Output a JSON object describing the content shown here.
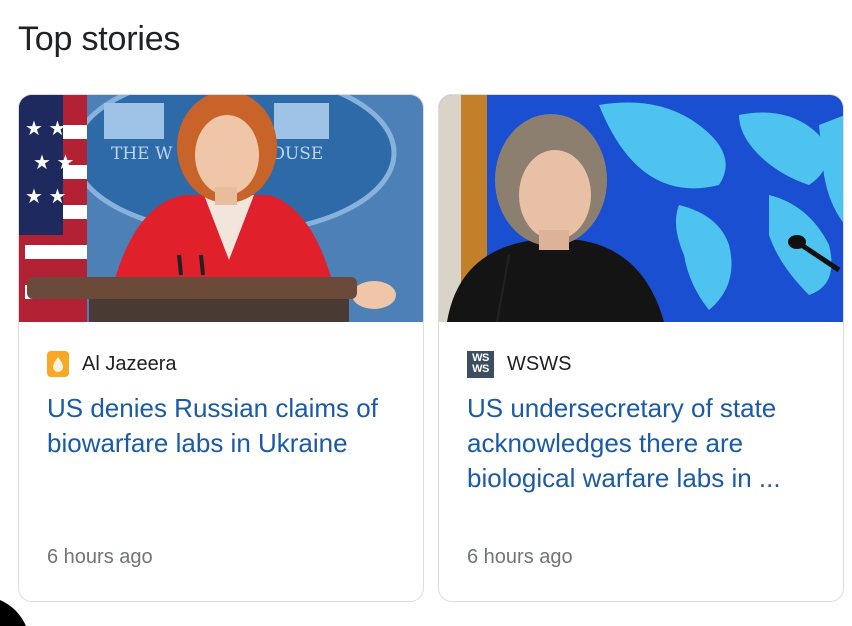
{
  "section": {
    "title": "Top stories"
  },
  "stories": [
    {
      "source": "Al Jazeera",
      "source_icon": "al-jazeera-logo-icon",
      "headline": "US denies Russian claims of biowarfare labs in Ukraine",
      "timestamp": "6 hours ago",
      "thumbnail_sign_left": "THE W",
      "thumbnail_sign_right": "OUSE"
    },
    {
      "source": "WSWS",
      "source_icon": "wsws-logo-icon",
      "logo_line1": "WS",
      "logo_line2": "WS",
      "headline": "US undersecretary of state acknowledges there are biological warfare labs in ...",
      "timestamp": "6 hours ago"
    }
  ],
  "colors": {
    "headline": "#1a5aa7",
    "source_text": "#202124",
    "timestamp": "#70757a",
    "card_border": "#dadce0"
  }
}
